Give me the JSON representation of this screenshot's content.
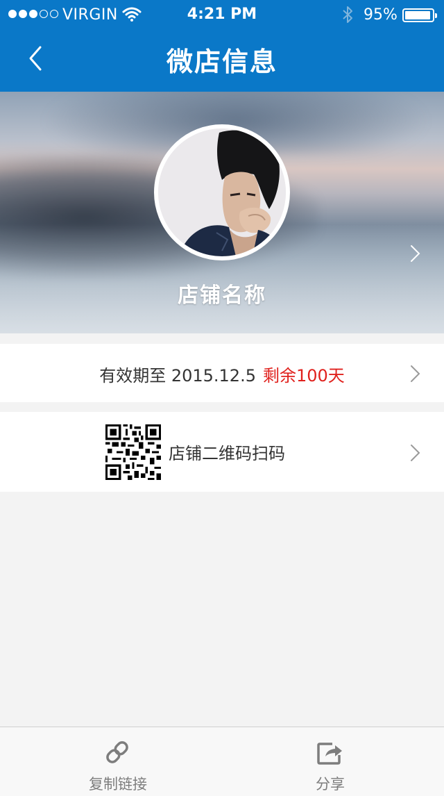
{
  "status_bar": {
    "carrier": "VIRGIN",
    "time": "4:21 PM",
    "battery_percent": "95%",
    "battery_level": 0.95,
    "signal_bars_filled": 3,
    "signal_bars_total": 5
  },
  "nav": {
    "title": "微店信息",
    "back_icon": "chevron-left-icon"
  },
  "profile": {
    "store_name": "店铺名称",
    "chevron_icon": "chevron-right-icon"
  },
  "validity": {
    "text": "有效期至 2015.12.5",
    "remaining": "剩余100天",
    "remaining_color": "#e0211d"
  },
  "qr_row": {
    "label": "店铺二维码扫码",
    "icon": "qr-code-icon"
  },
  "tabbar": {
    "copy_label": "复制链接",
    "copy_icon": "link-icon",
    "share_label": "分享",
    "share_icon": "share-icon"
  },
  "colors": {
    "header_blue": "#0a78c8",
    "background": "#f3f3f3",
    "accent_red": "#e0211d"
  }
}
